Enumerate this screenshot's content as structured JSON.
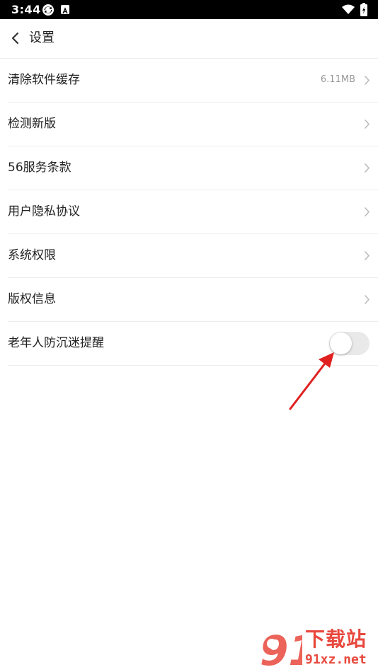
{
  "status_bar": {
    "time": "3:44",
    "icons": [
      "sync-icon",
      "a-badge-icon",
      "wifi-icon",
      "battery-charging-icon"
    ]
  },
  "nav": {
    "title": "设置",
    "back_icon": "chevron-left-icon"
  },
  "settings": {
    "items": [
      {
        "label": "清除软件缓存",
        "value": "6.11MB",
        "control": "chevron"
      },
      {
        "label": "检测新版",
        "value": "",
        "control": "chevron"
      },
      {
        "label": "56服务条款",
        "value": "",
        "control": "chevron"
      },
      {
        "label": "用户隐私协议",
        "value": "",
        "control": "chevron"
      },
      {
        "label": "系统权限",
        "value": "",
        "control": "chevron"
      },
      {
        "label": "版权信息",
        "value": "",
        "control": "chevron"
      },
      {
        "label": "老年人防沉迷提醒",
        "value": "",
        "control": "toggle",
        "toggle_on": false
      }
    ]
  },
  "annotation": {
    "arrow_color": "#e02020"
  },
  "watermark": {
    "logo_text": "91",
    "title": "下载站",
    "domain": "91xz.net",
    "color": "#e8483d"
  }
}
